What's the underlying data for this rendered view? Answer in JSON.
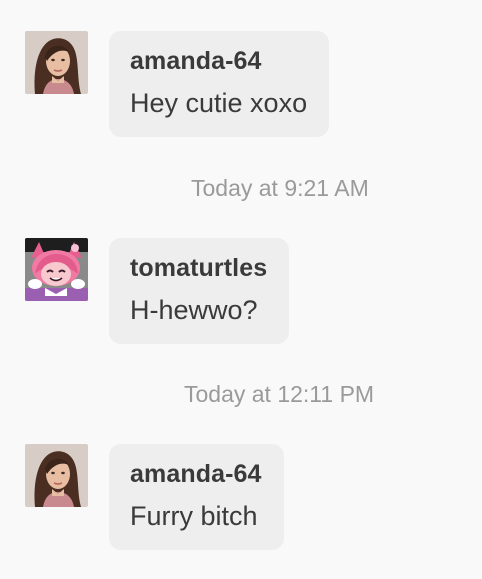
{
  "messages": [
    {
      "sender": "amanda-64",
      "text": "Hey cutie xoxo",
      "avatar_icon": "woman-portrait-avatar"
    },
    {
      "sender": "tomaturtles",
      "text": "H-hewwo?",
      "avatar_icon": "pink-anime-character-avatar"
    },
    {
      "sender": "amanda-64",
      "text": "Furry bitch",
      "avatar_icon": "woman-portrait-avatar"
    }
  ],
  "timestamps": [
    "Today at 9:21 AM",
    "Today at 12:11 PM"
  ],
  "colors": {
    "background": "#f9f9f9",
    "bubble": "#eeeeee",
    "text": "#3a3a3a",
    "timestamp": "#9a9a9a"
  }
}
